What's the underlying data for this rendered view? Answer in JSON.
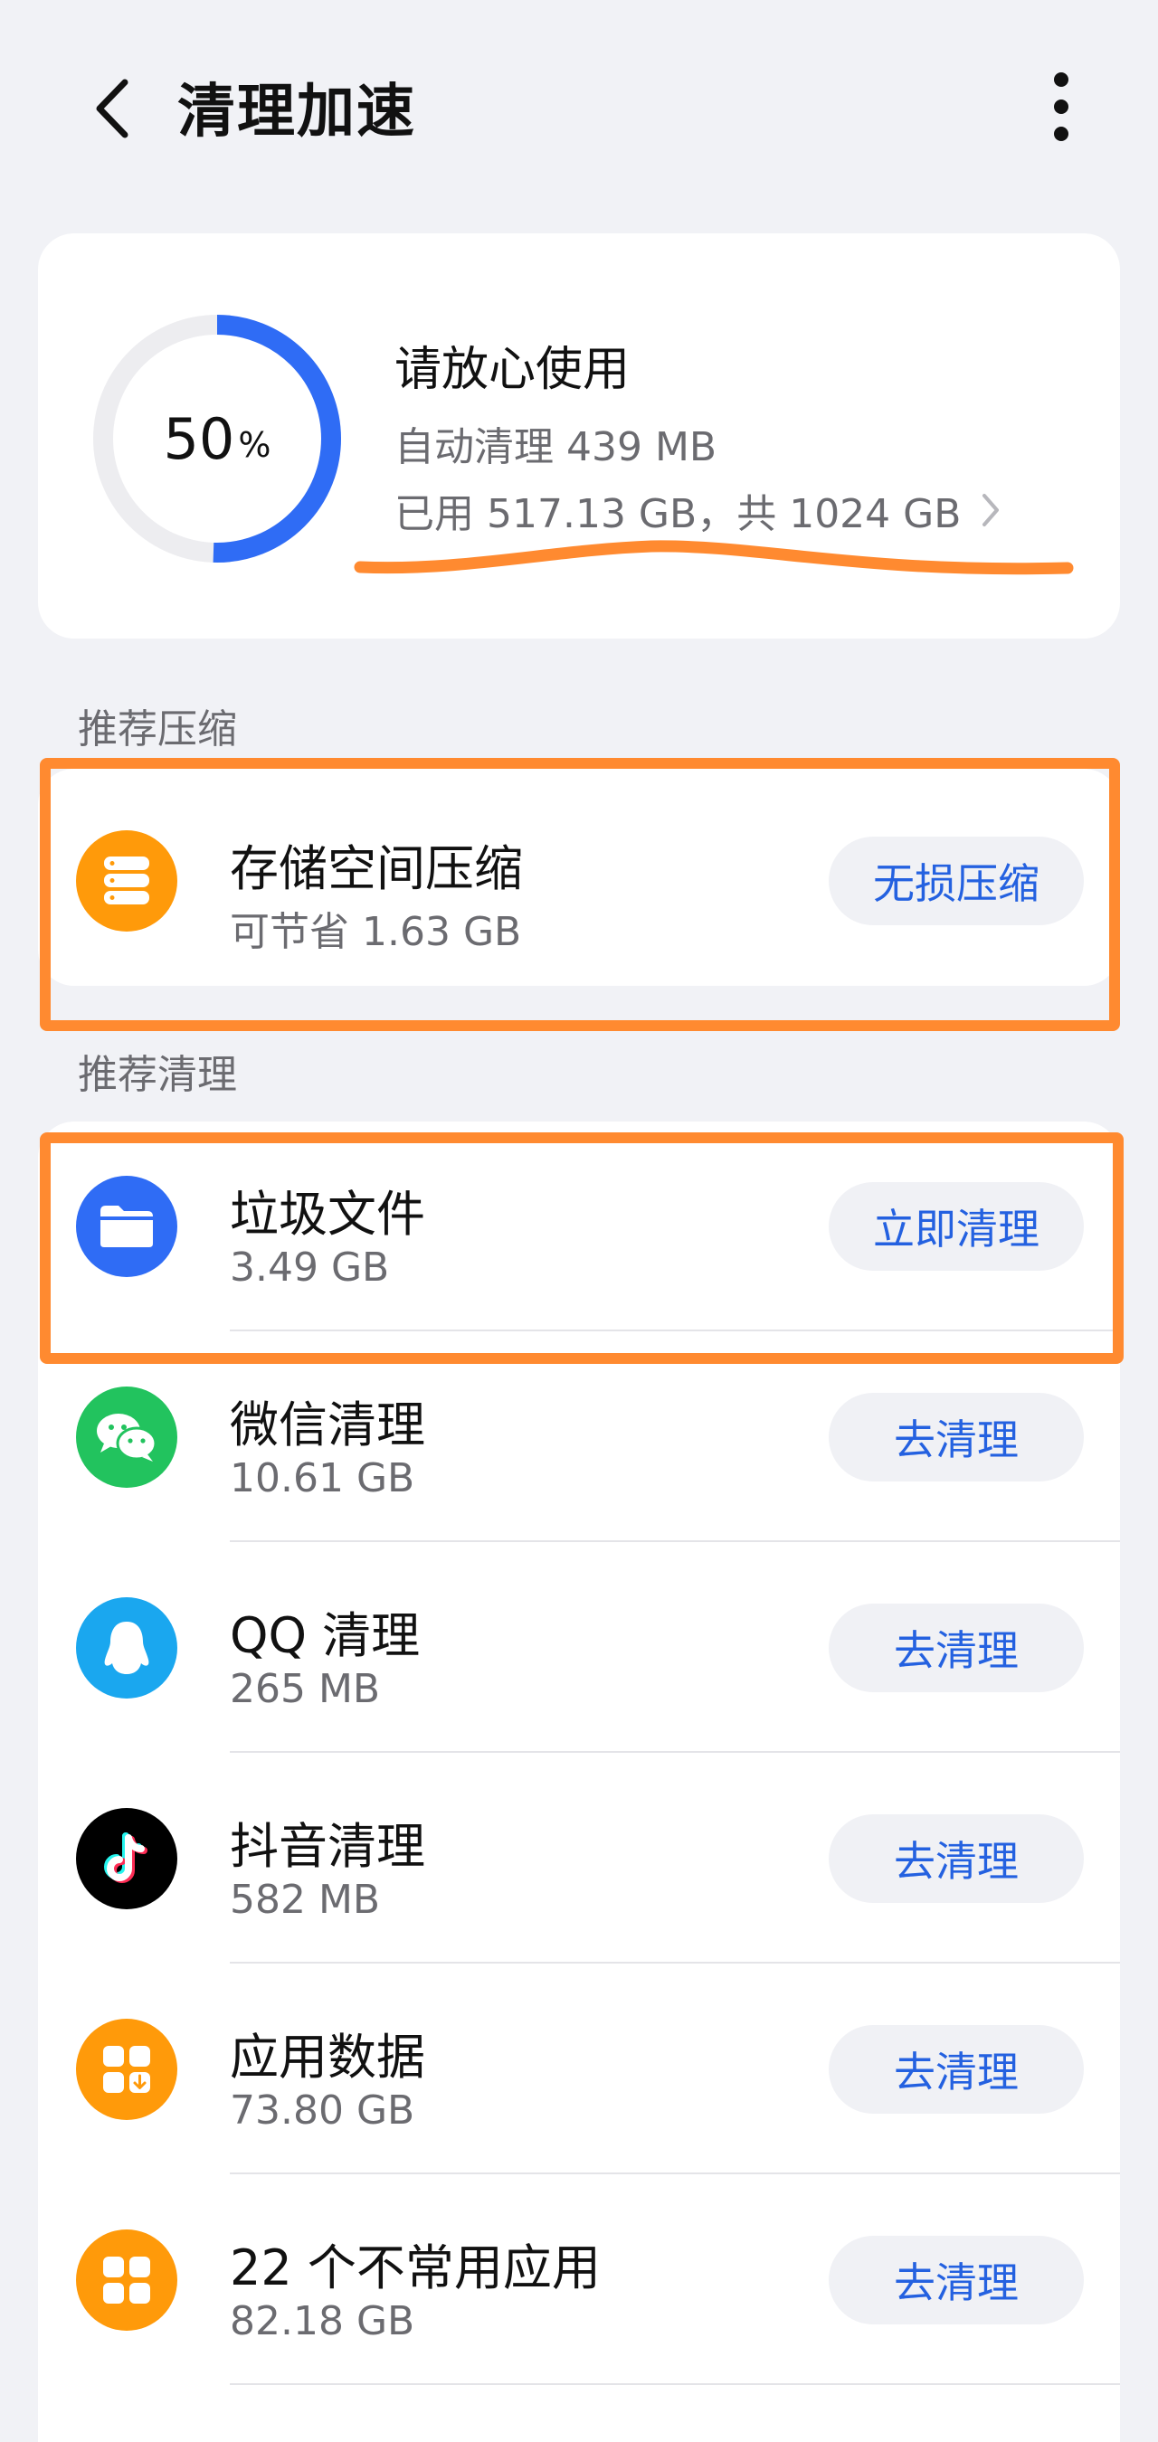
{
  "header": {
    "title": "清理加速"
  },
  "storage": {
    "percent": "50",
    "percent_sign": "%",
    "used_fraction": 0.505,
    "status": "请放心使用",
    "auto_clean": "自动清理 439 MB",
    "usage": "已用 517.13 GB，共 1024 GB"
  },
  "sections": {
    "compress_label": "推荐压缩",
    "clean_label": "推荐清理"
  },
  "compress": {
    "name": "存储空间压缩",
    "size": "可节省 1.63 GB",
    "button": "无损压缩"
  },
  "items": [
    {
      "name": "垃圾文件",
      "size": "3.49 GB",
      "button": "立即清理"
    },
    {
      "name": "微信清理",
      "size": "10.61 GB",
      "button": "去清理"
    },
    {
      "name": "QQ 清理",
      "size": "265 MB",
      "button": "去清理"
    },
    {
      "name": "抖音清理",
      "size": "582 MB",
      "button": "去清理"
    },
    {
      "name": "应用数据",
      "size": "73.80 GB",
      "button": "去清理"
    },
    {
      "name": "22 个不常用应用",
      "size": "82.18 GB",
      "button": "去清理"
    }
  ],
  "colors": {
    "accent": "#2461e0",
    "ring": "#2f6cf5",
    "annotation": "#ff8a30",
    "orange_icon": "#ff9a0a",
    "wechat": "#22c35e",
    "qq": "#1aa7ef",
    "douyin": "#000000"
  },
  "icons": {
    "back": "chevron-left-icon",
    "more": "more-vertical-icon",
    "compress": "storage-stack-icon",
    "junk": "folder-icon",
    "wechat": "wechat-icon",
    "qq": "qq-penguin-icon",
    "douyin": "douyin-icon",
    "app_data": "app-grid-download-icon",
    "unused_apps": "app-grid-icon"
  }
}
